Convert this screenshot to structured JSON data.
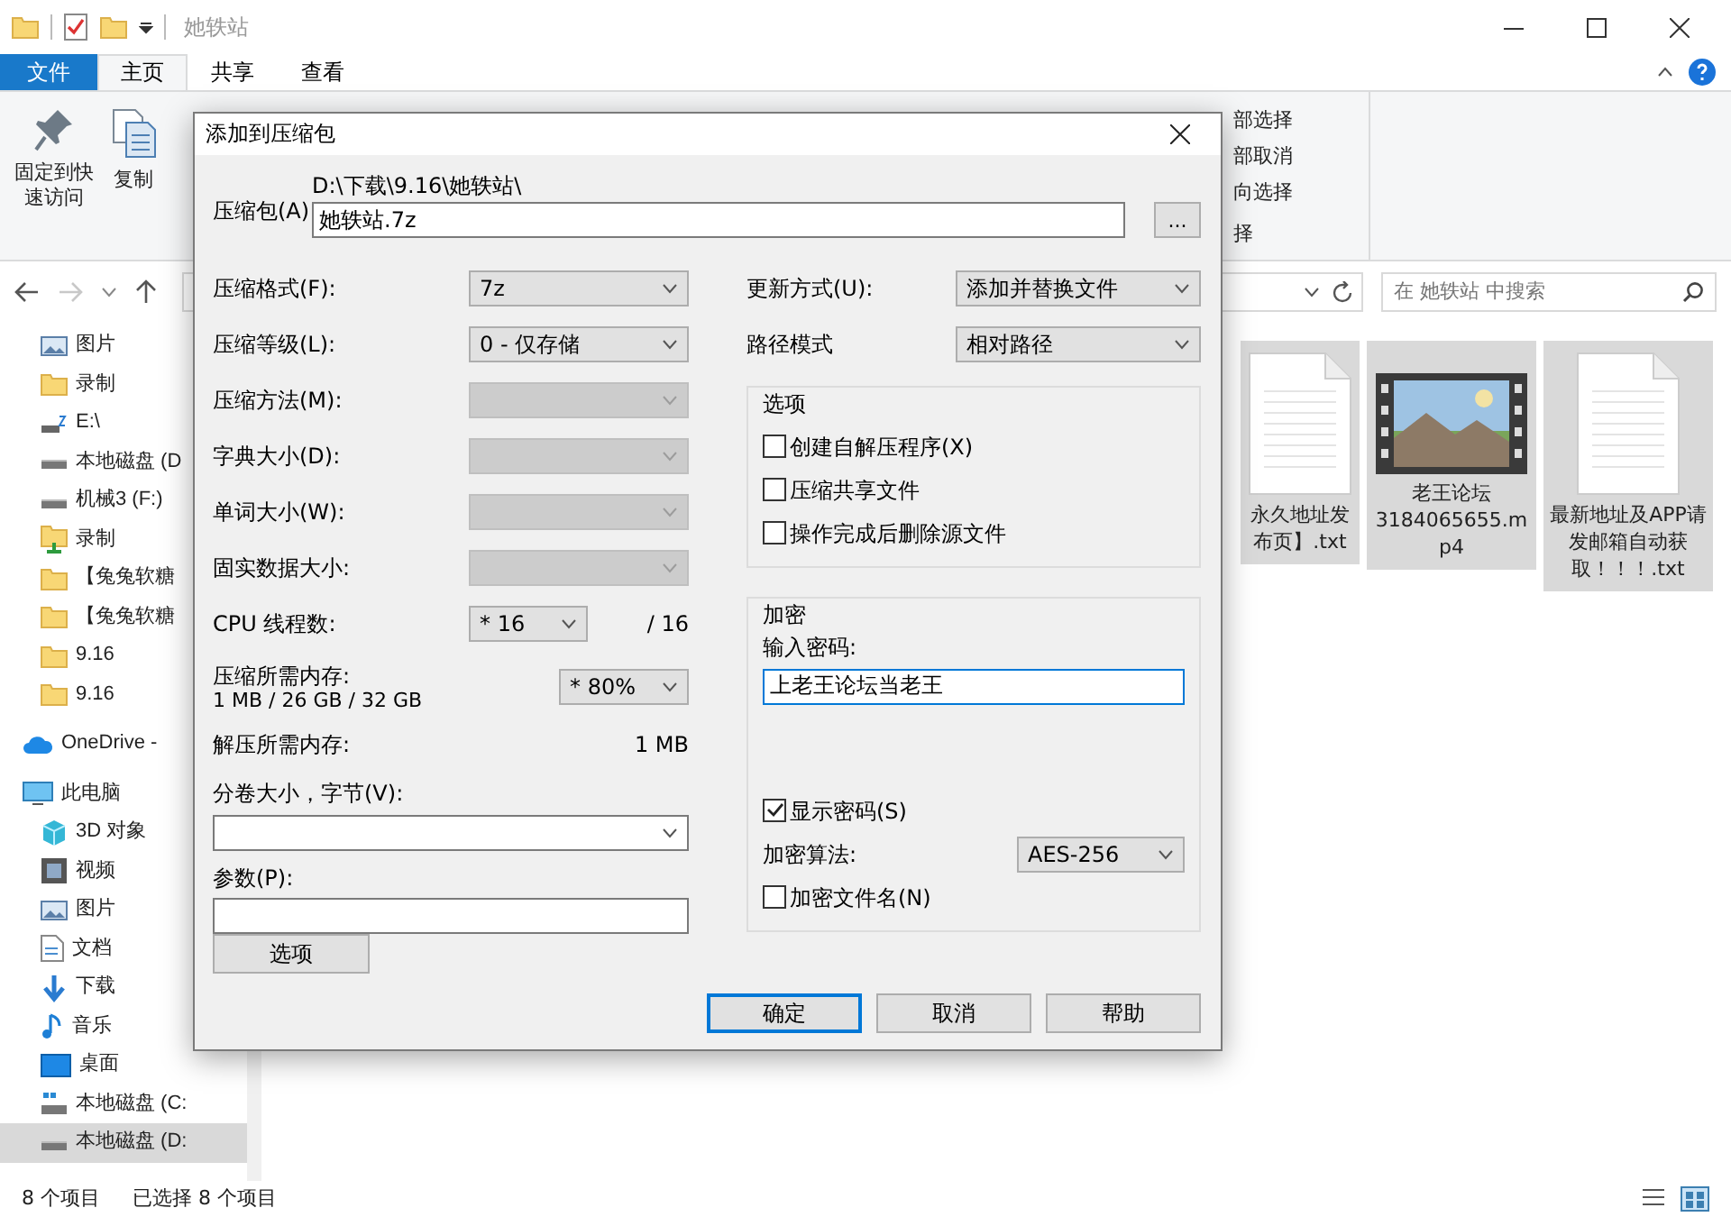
{
  "window": {
    "title": "她轶站"
  },
  "ribbon": {
    "tabs": [
      {
        "label": "文件",
        "kind": "menu",
        "selected": false
      },
      {
        "label": "主页",
        "kind": "tab",
        "selected": true
      },
      {
        "label": "共享",
        "kind": "tab",
        "selected": false
      },
      {
        "label": "查看",
        "kind": "tab",
        "selected": false
      }
    ],
    "commands": [
      {
        "label": "固定到快速访问",
        "kind": "pin"
      },
      {
        "label": "复制",
        "kind": "copy"
      }
    ],
    "select_commands": [
      "部选择",
      "部取消",
      "向选择"
    ],
    "group_label": "择"
  },
  "search": {
    "placeholder": "在 她轶站 中搜索"
  },
  "nav_pane": {
    "pinned": [
      {
        "label": "图片",
        "kind": "pictures",
        "selected": false
      },
      {
        "label": "录制",
        "kind": "folder",
        "selected": false
      },
      {
        "label": "E:\\",
        "kind": "netdrive",
        "selected": false
      },
      {
        "label": "本地磁盘 (D",
        "kind": "drive",
        "selected": false
      },
      {
        "label": "机械3 (F:)",
        "kind": "drive",
        "selected": false
      },
      {
        "label": "录制",
        "kind": "folder_sync",
        "selected": false
      },
      {
        "label": "【兔兔软糖",
        "kind": "folder",
        "selected": false
      },
      {
        "label": "【兔兔软糖",
        "kind": "folder",
        "selected": false
      },
      {
        "label": "9.16",
        "kind": "folder",
        "selected": false
      },
      {
        "label": "9.16",
        "kind": "folder",
        "selected": false
      }
    ],
    "roots": [
      {
        "label": "OneDrive -",
        "kind": "cloud",
        "selected": false
      },
      {
        "label": "此电脑",
        "kind": "pc",
        "selected": false,
        "children": [
          {
            "label": "3D 对象",
            "kind": "objects3d",
            "selected": false
          },
          {
            "label": "视频",
            "kind": "videos",
            "selected": false
          },
          {
            "label": "图片",
            "kind": "pictures",
            "selected": false
          },
          {
            "label": "文档",
            "kind": "documents",
            "selected": false
          },
          {
            "label": "下载",
            "kind": "downloads",
            "selected": false
          },
          {
            "label": "音乐",
            "kind": "music",
            "selected": false
          },
          {
            "label": "桌面",
            "kind": "desktop",
            "selected": false
          },
          {
            "label": "本地磁盘 (C:",
            "kind": "drive_system",
            "selected": false
          },
          {
            "label": "本地磁盘 (D:",
            "kind": "drive",
            "selected": true
          }
        ]
      }
    ]
  },
  "files": [
    {
      "name": "永久地址发布页】.txt",
      "kind": "text",
      "selected": true
    },
    {
      "name": "老王论坛3184065655.mp4",
      "kind": "video",
      "selected": true
    },
    {
      "name": "最新地址及APP请发邮箱自动获取！！！.txt",
      "kind": "text",
      "selected": true
    }
  ],
  "status_bar": {
    "item_count": "8 个项目",
    "selection": "已选择 8 个项目"
  },
  "dialog": {
    "title": "添加到压缩包",
    "archive_label": "压缩包(A)",
    "archive_path": "D:\\下载\\9.16\\她轶站\\",
    "archive_name": "她轶站.7z",
    "browse": "...",
    "left": [
      {
        "kind": "select",
        "label": "压缩格式(F):",
        "value": "7z",
        "disabled": false
      },
      {
        "kind": "select",
        "label": "压缩等级(L):",
        "value": "0 - 仅存储",
        "disabled": false
      },
      {
        "kind": "select",
        "label": "压缩方法(M):",
        "disabled": true
      },
      {
        "kind": "select",
        "label": "字典大小(D):",
        "disabled": true
      },
      {
        "kind": "select",
        "label": "单词大小(W):",
        "disabled": true
      },
      {
        "kind": "select",
        "label": "固实数据大小:",
        "disabled": true
      },
      {
        "kind": "threads",
        "label": "CPU 线程数:",
        "value": "* 16",
        "suffix": "/ 16"
      },
      {
        "kind": "memory",
        "label": "压缩所需内存:",
        "detail": "1 MB / 26 GB / 32 GB",
        "value": "* 80%"
      },
      {
        "kind": "readout",
        "label": "解压所需内存:",
        "value": "1 MB"
      },
      {
        "kind": "combo_full",
        "label": "分卷大小，字节(V):"
      },
      {
        "kind": "text_full",
        "label": "参数(P):"
      }
    ],
    "options_button": "选项",
    "update_mode": {
      "label": "更新方式(U):",
      "value": "添加并替换文件"
    },
    "path_mode": {
      "label": "路径模式",
      "value": "相对路径"
    },
    "options": {
      "title": "选项",
      "checks": [
        {
          "label": "创建自解压程序(X)",
          "checked": false
        },
        {
          "label": "压缩共享文件",
          "checked": false
        },
        {
          "label": "操作完成后删除源文件",
          "checked": false
        }
      ]
    },
    "encryption": {
      "title": "加密",
      "password_label": "输入密码:",
      "password": "上老王论坛当老王",
      "show_password": {
        "label": "显示密码(S)",
        "checked": true
      },
      "method_label": "加密算法:",
      "method": "AES-256",
      "encrypt_names": {
        "label": "加密文件名(N)",
        "checked": false
      }
    },
    "buttons": [
      {
        "label": "确定",
        "default": true
      },
      {
        "label": "取消",
        "default": false
      },
      {
        "label": "帮助",
        "default": false
      }
    ]
  }
}
